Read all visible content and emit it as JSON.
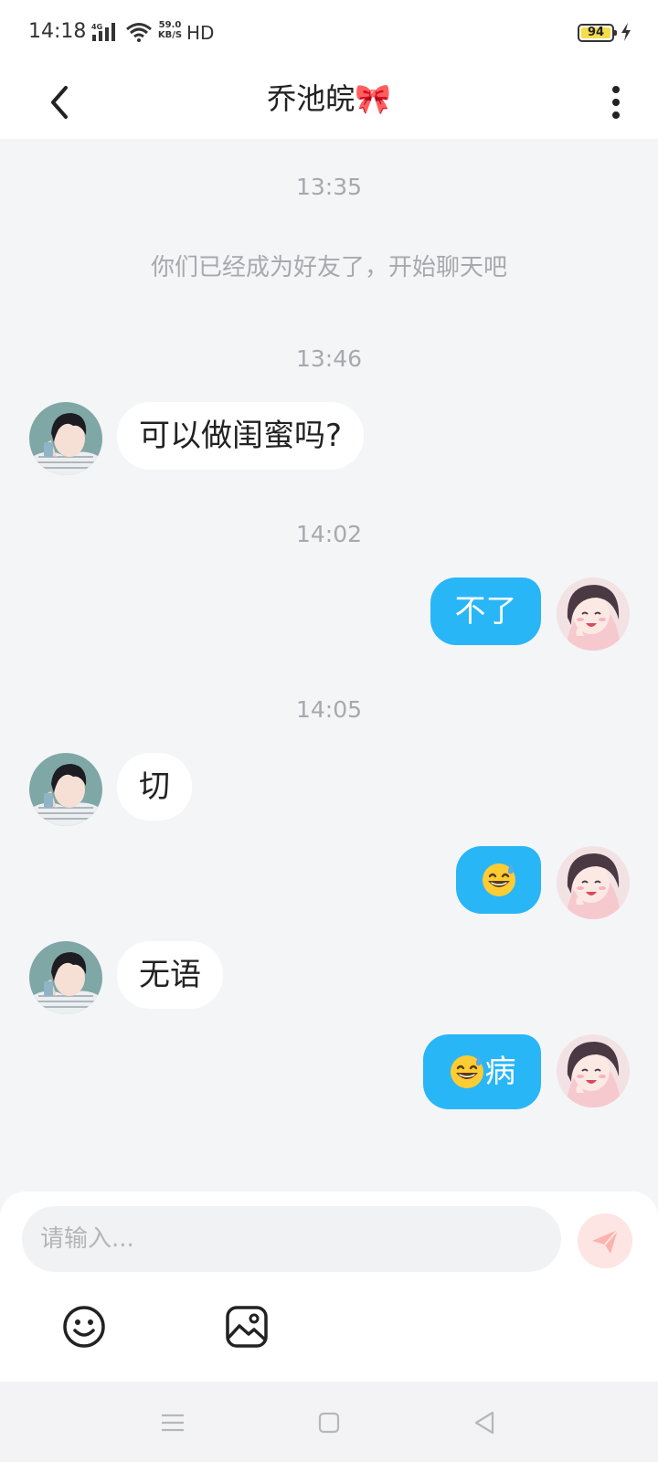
{
  "status_bar": {
    "time": "14:18",
    "network_type": "4G",
    "speed_value": "59.0",
    "speed_unit": "KB/S",
    "hd_label": "HD",
    "battery": "94"
  },
  "header": {
    "title": "乔池皖",
    "title_emoji": "🎀"
  },
  "chat": {
    "system_time": "13:35",
    "system_message": "你们已经成为好友了，开始聊天吧",
    "groups": [
      {
        "time": "13:46"
      },
      {
        "time": "14:02"
      },
      {
        "time": "14:05"
      }
    ],
    "messages": [
      {
        "from": "contact",
        "text": "可以做闺蜜吗?"
      },
      {
        "from": "me",
        "text": "不了"
      },
      {
        "from": "contact",
        "text": "切"
      },
      {
        "from": "me",
        "emoji": "grinning-sweat-emoji",
        "text": ""
      },
      {
        "from": "contact",
        "text": "无语"
      },
      {
        "from": "me",
        "emoji": "grinning-sweat-emoji",
        "text": "病"
      }
    ]
  },
  "composer": {
    "placeholder": "请输入...",
    "send_icon": "send-icon",
    "emoji_icon": "smiley-icon",
    "image_icon": "image-icon"
  },
  "colors": {
    "bubble_out": "#29b6f6",
    "bubble_in": "#ffffff",
    "background": "#f4f5f7",
    "send_button": "#fde5e3",
    "send_arrow": "#fbb3ab"
  }
}
